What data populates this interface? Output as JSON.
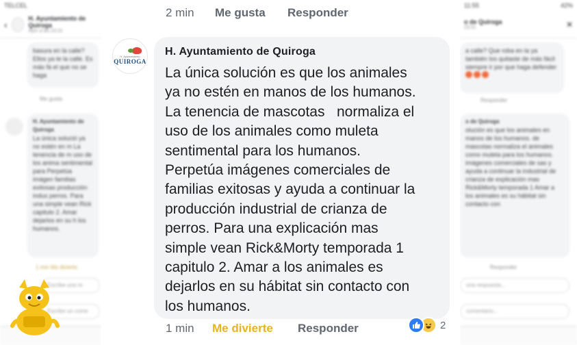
{
  "background_left": {
    "status_time": "TELCEL",
    "header_title": "H. Ayuntamiento de Quiroga",
    "header_sub": "Ayer a las 23:31",
    "bubble1": "basura en la calle? Ellos ya te la calle. Es más fá el que no se haga",
    "meta1": "Me gusta",
    "bubble2_author": "H. Ayuntamiento de Quiroga",
    "bubble2": "La única solució ya no estén en m La tenencia de m uso de los anima sentimental para Perpetúa imágen familias exitosas producción indus perros. Para una simple vean Rick capitulo 2. Amar dejarlos en su h los humanos.",
    "meta2": "1 min  Me divierte",
    "input1": "Escribe una re",
    "input2": "Escribe un come"
  },
  "background_right": {
    "status_time": "11:55",
    "status_battery": "42%",
    "header_title": "o de Quiroga",
    "header_sub": "23:31",
    "bubble1": "a calle? Que roba en la ya también los quitaste de más fácil siempre ir por que haga defender",
    "meta1": "Responder",
    "bubble2_author": "o de Quiroga",
    "bubble2": "olución es que los animales en manos de los humanos. de mascotas normaliza el animales como muleta para los humanos. imágenes comerciales de sas y ayuda a continuar la industrial de crianza de explicación mas Rick&Morty temporada 1 Amar a los animales es su hábitat sin contacto con",
    "meta2": "Responder",
    "input1": "una respuesta...",
    "input2": "comentario..."
  },
  "top_actions": {
    "time": "2 min",
    "like": "Me gusta",
    "reply": "Responder"
  },
  "comment": {
    "avatar_brand": "QUIROGA",
    "avatar_tagline": "H. Ayuntamiento",
    "author": "H. Ayuntamiento de Quiroga",
    "lines": [
      "La única solución es que los animales",
      "ya no estén en manos de los humanos.",
      "La tenencia de mascotas   normaliza el",
      "uso de los animales como muleta",
      "sentimental para los humanos.",
      "Perpetúa imágenes comerciales de",
      "familias exitosas y ayuda a continuar la",
      "producción industrial de crianza de",
      "perros. Para una explicación mas",
      "simple vean Rick&Morty temporada 1",
      "capitulo 2. Amar a los animales es",
      "dejarlos en su hábitat sin contacto con",
      "los humanos."
    ]
  },
  "bottom_actions": {
    "time": "1 min",
    "reaction": "Me divierte",
    "reply": "Responder"
  },
  "reactions": {
    "like_icon": "thumbs-up-icon",
    "haha_icon": "laughing-face-icon",
    "count": "2",
    "colors": {
      "like": "#2d7cf6",
      "haha": "#f7c948",
      "reaction_text": "#e8b320"
    }
  }
}
